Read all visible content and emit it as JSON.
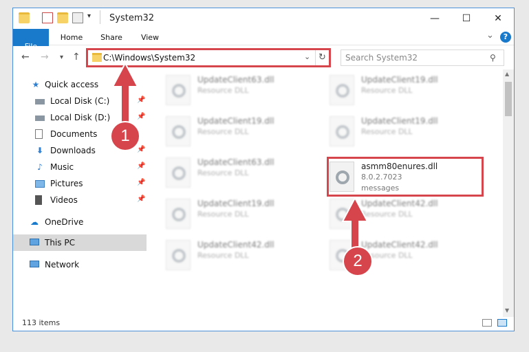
{
  "window": {
    "title": "System32",
    "minimize": "—",
    "maximize": "☐",
    "close": "✕"
  },
  "ribbon": {
    "tabs": [
      {
        "label": "File"
      },
      {
        "label": "Home"
      },
      {
        "label": "Share"
      },
      {
        "label": "View"
      }
    ],
    "help": "?",
    "expand": "⌄"
  },
  "address": {
    "path": "C:\\Windows\\System32",
    "search_placeholder": "Search System32"
  },
  "nav": {
    "back": "←",
    "forward": "→",
    "recent": "▾",
    "up": "↑"
  },
  "sidebar": {
    "items": [
      {
        "label": "Quick access",
        "icon": "star-icon"
      },
      {
        "label": "Local Disk (C:)",
        "icon": "drive-icon"
      },
      {
        "label": "Local Disk (D:)",
        "icon": "drive-icon"
      },
      {
        "label": "Documents",
        "icon": "document-icon"
      },
      {
        "label": "Downloads",
        "icon": "download-icon"
      },
      {
        "label": "Music",
        "icon": "music-icon"
      },
      {
        "label": "Pictures",
        "icon": "picture-icon"
      },
      {
        "label": "Videos",
        "icon": "video-icon"
      },
      {
        "label": "OneDrive",
        "icon": "cloud-icon"
      },
      {
        "label": "This PC",
        "icon": "computer-icon"
      },
      {
        "label": "Network",
        "icon": "network-icon"
      }
    ]
  },
  "files": [
    {
      "name": "UpdateClient63.dll",
      "sub1": "Resource DLL"
    },
    {
      "name": "UpdateClient19.dll",
      "sub1": "Resource DLL"
    },
    {
      "name": "UpdateClient19.dll",
      "sub1": "Resource DLL"
    },
    {
      "name": "UpdateClient19.dll",
      "sub1": "Resource DLL"
    },
    {
      "name": "UpdateClient63.dll",
      "sub1": "Resource DLL"
    },
    {
      "name": "asmm80enures.dll",
      "sub1": "8.0.2.7023",
      "sub2": "messages"
    },
    {
      "name": "UpdateClient19.dll",
      "sub1": "Resource DLL"
    },
    {
      "name": "UpdateClient42.dll",
      "sub1": "Resource DLL"
    },
    {
      "name": "UpdateClient42.dll",
      "sub1": "Resource DLL"
    },
    {
      "name": "UpdateClient42.dll",
      "sub1": "Resource DLL"
    }
  ],
  "status": {
    "count": "113 items"
  },
  "annotations": {
    "badge1": "1",
    "badge2": "2",
    "color": "#d6454c"
  }
}
